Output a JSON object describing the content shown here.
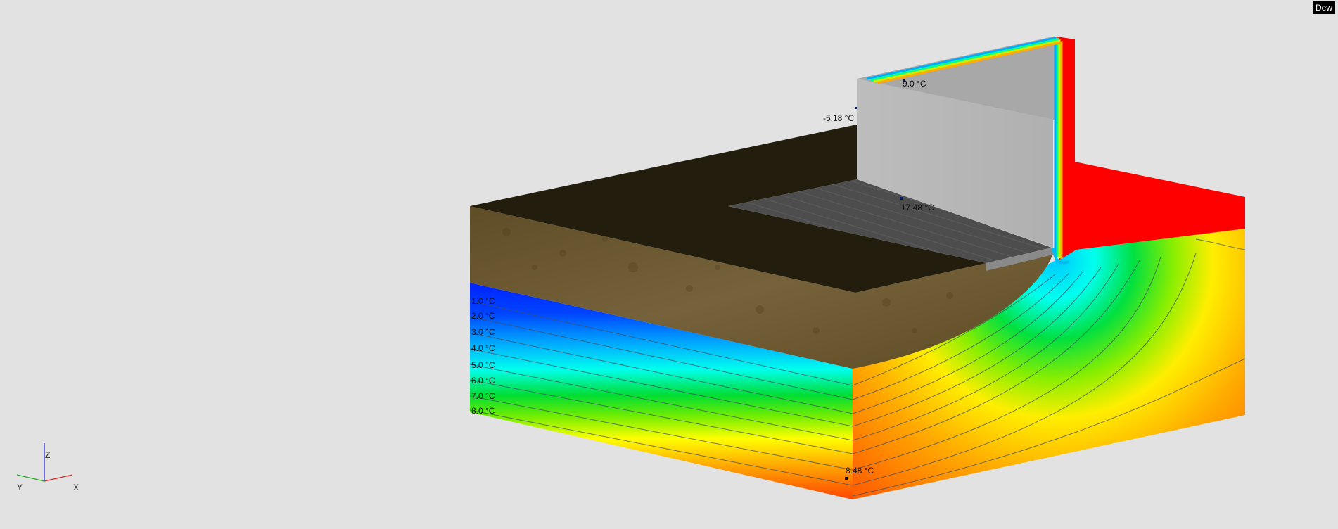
{
  "mode_button": {
    "label": "Dew"
  },
  "colors": {
    "background": "#e2e2e2",
    "soil_top": "#231d0e",
    "soil_side": "#6e5a2e",
    "wall_face": "#b5b5b5",
    "floor": "#4a4a4a",
    "warm_region": "#ff0000"
  },
  "isotherm_labels": [
    "1.0 °C",
    "2.0 °C",
    "3.0 °C",
    "4.0 °C",
    "5.0 °C",
    "6.0 °C",
    "7.0 °C",
    "8.0 °C"
  ],
  "probes": {
    "top": {
      "label": "9.0 °C"
    },
    "outer_wall": {
      "label": "-5.18 °C"
    },
    "inner_wall": {
      "label": "17.48 °C"
    },
    "ground": {
      "label": "8.48 °C"
    }
  },
  "axes": {
    "z": "Z",
    "y": "Y",
    "x": "X"
  },
  "triad_icon": "coordinate-axes-icon"
}
